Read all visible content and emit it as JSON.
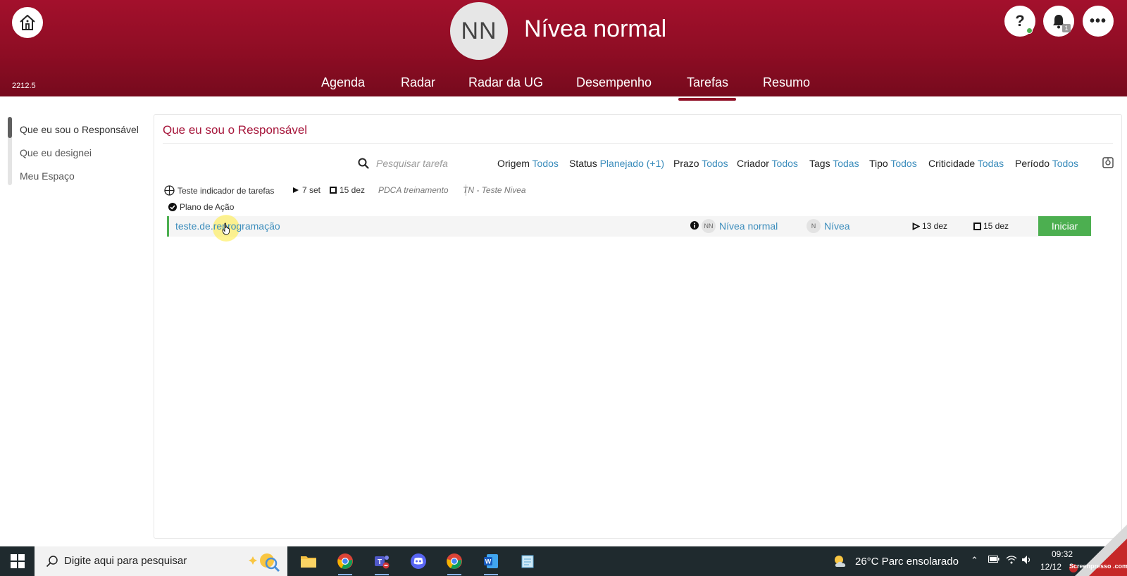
{
  "header": {
    "avatar_initials": "NN",
    "user_name": "Nívea normal",
    "version": "2212.5",
    "notification_count": "1",
    "help_label": "?",
    "more_label": "•••",
    "nav": [
      "Agenda",
      "Radar",
      "Radar da UG",
      "Desempenho",
      "Tarefas",
      "Resumo"
    ],
    "active_nav": "Tarefas"
  },
  "sidebar": {
    "items": [
      {
        "label": "Que eu sou o Responsável",
        "active": true
      },
      {
        "label": "Que eu designei",
        "active": false
      },
      {
        "label": "Meu Espaço",
        "active": false
      }
    ]
  },
  "main": {
    "title": "Que eu sou o Responsável",
    "search_placeholder": "Pesquisar tarefa",
    "filters": [
      {
        "label": "Origem",
        "value": "Todos"
      },
      {
        "label": "Status",
        "value": "Planejado (+1)"
      },
      {
        "label": "Prazo",
        "value": "Todos"
      },
      {
        "label": "Criador",
        "value": "Todos"
      },
      {
        "label": "Tags",
        "value": "Todas"
      },
      {
        "label": "Tipo",
        "value": "Todos"
      },
      {
        "label": "Criticidade",
        "value": "Todas"
      },
      {
        "label": "Período",
        "value": "Todos"
      }
    ],
    "task_group": {
      "indicator": "Teste indicador de tarefas",
      "start": "7 set",
      "end": "15 dez",
      "pdca": "PDCA treinamento",
      "unit": "TN - Teste Nivea",
      "plan_label": "Plano de Ação"
    },
    "task": {
      "name": "teste.de.reprogramação",
      "responsible_initials": "NN",
      "responsible": "Nívea normal",
      "creator_initials": "N",
      "creator": "Nívea",
      "start": "13 dez",
      "end": "15 dez",
      "action_label": "Iniciar",
      "status_color": "#4caf50"
    }
  },
  "taskbar": {
    "search_text": "Digite aqui para pesquisar",
    "weather": "26°C  Parc ensolarado",
    "time": "09:32",
    "date": "12/12",
    "apps": [
      "file-explorer",
      "chrome",
      "teams",
      "discord",
      "chrome",
      "word",
      "notepad"
    ],
    "watermark": "Screenpresso .com"
  },
  "colors": {
    "header": "#8e0d24",
    "title": "#a6153a",
    "link": "#3c8dbc",
    "accent_green": "#4caf50"
  }
}
